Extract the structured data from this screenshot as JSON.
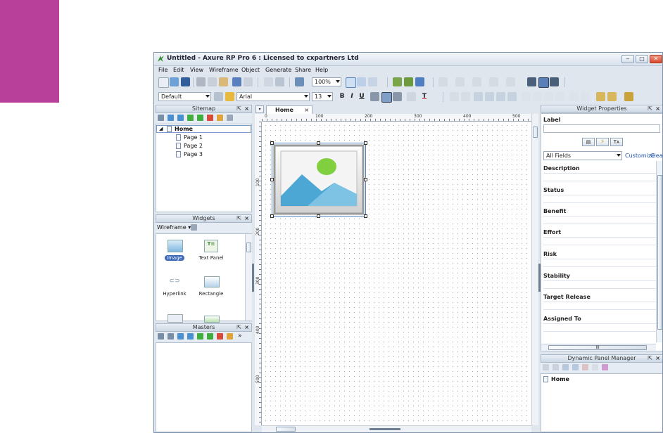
{
  "window": {
    "title": "Untitled - Axure RP Pro 6 : Licensed to cxpartners Ltd",
    "min_glyph": "‒",
    "max_glyph": "□",
    "close_glyph": "✕"
  },
  "menu": [
    "File",
    "Edit",
    "View",
    "Wireframe",
    "Object",
    "Generate",
    "Share",
    "Help"
  ],
  "toolbar": {
    "zoom": "100%",
    "style_select": "Default",
    "font_select": "Arial",
    "font_size": "13",
    "bold": "B",
    "italic": "I",
    "underline": "U",
    "text_color": "T"
  },
  "sitemap": {
    "title": "Sitemap",
    "root": "Home",
    "pages": [
      "Page 1",
      "Page 2",
      "Page 3"
    ]
  },
  "widgets": {
    "title": "Widgets",
    "library": "Wireframe",
    "items": [
      "Image",
      "Text Panel",
      "Hyperlink",
      "Rectangle"
    ]
  },
  "masters": {
    "title": "Masters"
  },
  "canvas": {
    "tab": "Home",
    "tab_close": "×",
    "ruler_h": [
      "0",
      "100",
      "200",
      "300",
      "400",
      "500"
    ],
    "ruler_v": [
      "100",
      "200",
      "300",
      "400",
      "500"
    ]
  },
  "widget_properties": {
    "title": "Widget Properties",
    "label_field": "Label",
    "fields_select": "All Fields",
    "customize": "Customize",
    "clear": "Clear",
    "fields": [
      "Description",
      "Status",
      "Benefit",
      "Effort",
      "Risk",
      "Stability",
      "Target Release",
      "Assigned To"
    ],
    "scroll_label": "III"
  },
  "dynamic_panel_manager": {
    "title": "Dynamic Panel Manager",
    "root": "Home"
  },
  "colors": {
    "accent": "#b8409a",
    "window_bg": "#dfe6ee",
    "image_placeholder_sky": "#3b9fd0",
    "image_placeholder_sun": "#7fcf3e"
  }
}
